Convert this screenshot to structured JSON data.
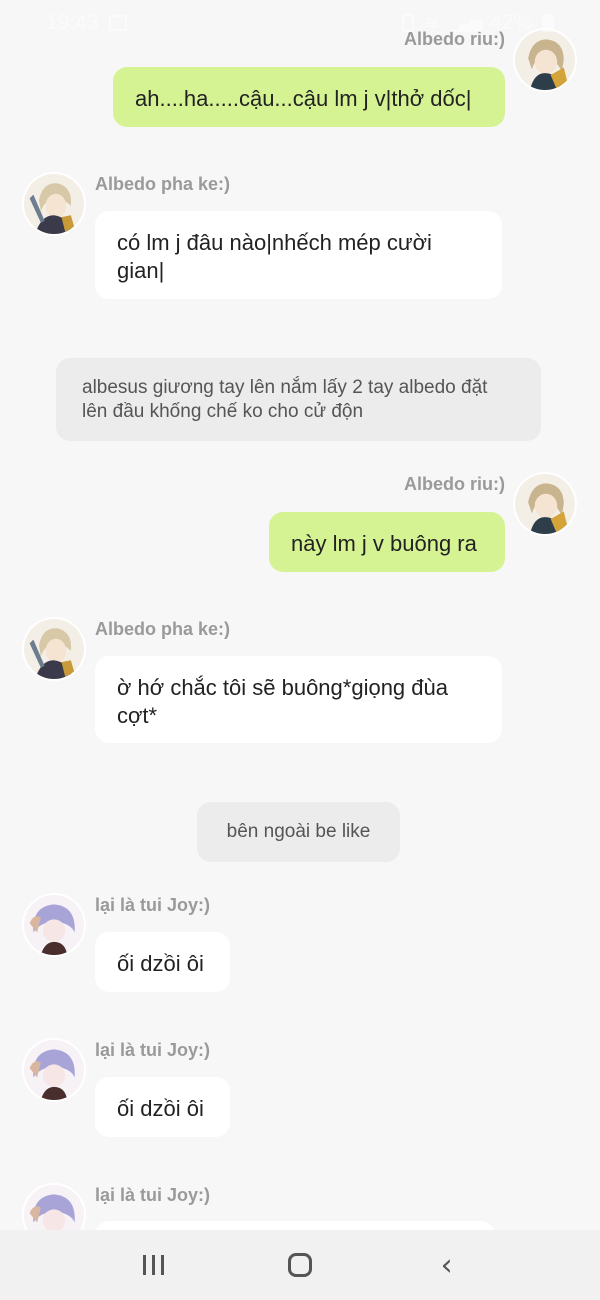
{
  "status_bar": {
    "time": "19:43",
    "battery": "42%"
  },
  "messages": [
    {
      "sender": "Albedo riu:)",
      "text": "ah....ha.....cậu...cậu lm j v|thở dốc|",
      "side": "right"
    },
    {
      "sender": "Albedo pha ke:)",
      "text": "có lm j đâu nào|nhếch mép cười gian|",
      "side": "left"
    },
    {
      "narration": "albesus giương tay lên nắm lấy 2 tay albedo đặt lên đầu khống chế ko cho cử độn"
    },
    {
      "sender": "Albedo riu:)",
      "text": "này lm j v buông ra",
      "side": "right"
    },
    {
      "sender": "Albedo pha ke:)",
      "text": "ờ hớ chắc tôi sẽ buông*giọng đùa cợt*",
      "side": "left"
    },
    {
      "narration": "bên ngoài be like"
    },
    {
      "sender": "lại là tui Joy:)",
      "text": "ối dzồi ôi",
      "side": "left"
    },
    {
      "sender": "lại là tui Joy:)",
      "text": "ối dzồi ôi",
      "side": "left"
    },
    {
      "sender": "lại là tui Joy:)",
      "text": "",
      "side": "left"
    }
  ],
  "colors": {
    "background": "#f7f7f7",
    "right_bubble": "#d6f394",
    "left_bubble": "#ffffff",
    "narration": "#ececec",
    "name_text": "#9a9a9a"
  },
  "icons": {
    "nav_recents": "recents-icon",
    "nav_home": "home-icon",
    "nav_back": "back-icon"
  }
}
